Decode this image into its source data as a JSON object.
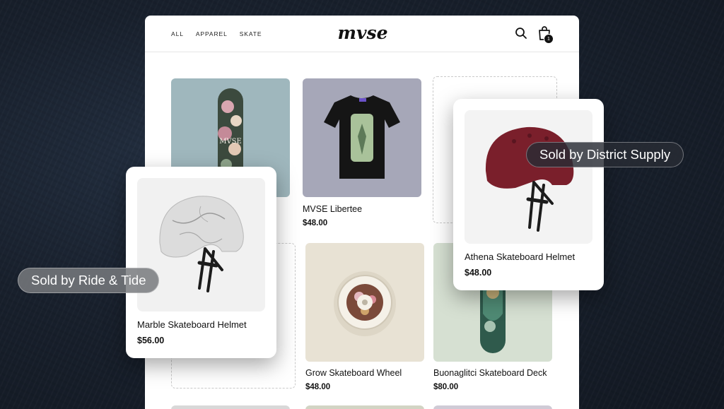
{
  "nav": {
    "items": [
      "ALL",
      "APPAREL",
      "SKATE"
    ]
  },
  "store": {
    "logo_text": "mvse",
    "cart_count": "1"
  },
  "products": [
    {
      "name": "MVSE Libertee",
      "price": "$48.00"
    },
    {
      "name": "Grow Skateboard Wheel",
      "price": "$48.00"
    },
    {
      "name": "Buonaglitci Skateboard Deck",
      "price": "$80.00"
    }
  ],
  "cards": {
    "marble": {
      "name": "Marble Skateboard Helmet",
      "price": "$56.00",
      "seller": "Sold by Ride & Tide"
    },
    "athena": {
      "name": "Athena Skateboard Helmet",
      "price": "$48.00",
      "seller": "Sold by District Supply"
    }
  },
  "colors": {
    "background": "#18202c",
    "helmet_red": "#7a1f2b",
    "deck_tile": "#9fb7bd",
    "tee_tile": "#a6a7b8",
    "wheel_tile": "#e8e2d4",
    "deck2_tile": "#d6e0d2"
  },
  "icons": [
    "search-icon",
    "shopping-bag-icon"
  ]
}
